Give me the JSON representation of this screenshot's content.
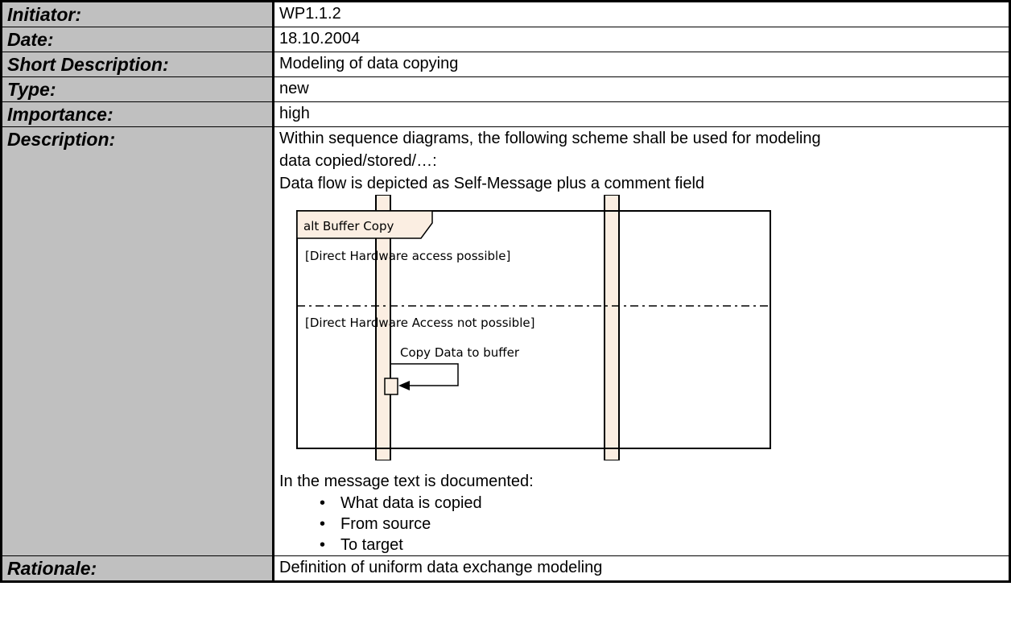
{
  "rows": {
    "initiator": {
      "label": "Initiator:",
      "value": "WP1.1.2"
    },
    "date": {
      "label": "Date:",
      "value": "18.10.2004"
    },
    "short": {
      "label": "Short Description:",
      "value": "Modeling of data copying"
    },
    "type": {
      "label": "Type:",
      "value": "new"
    },
    "importance": {
      "label": "Importance:",
      "value": "high"
    },
    "description": {
      "label": "Description:",
      "lines": [
        "Within sequence diagrams, the following scheme shall be used for modeling",
        "data copied/stored/…:",
        "Data flow is depicted as Self-Message plus a comment field"
      ],
      "after_diagram": "In the message text is documented:",
      "bullet_symbol": "•",
      "bullets": [
        "What data is copied",
        "From source",
        "To target"
      ]
    },
    "rationale": {
      "label": "Rationale:",
      "value": "Definition of uniform data exchange modeling"
    }
  },
  "diagram": {
    "fragment_label": "alt Buffer Copy",
    "guard_1": "[Direct Hardware access possible]",
    "guard_2": "[Direct Hardware Access not possible]",
    "message": "Copy Data to buffer",
    "colors": {
      "lifeline_fill": "#fbeee2",
      "frame_tab_fill": "#fbeee2"
    }
  }
}
